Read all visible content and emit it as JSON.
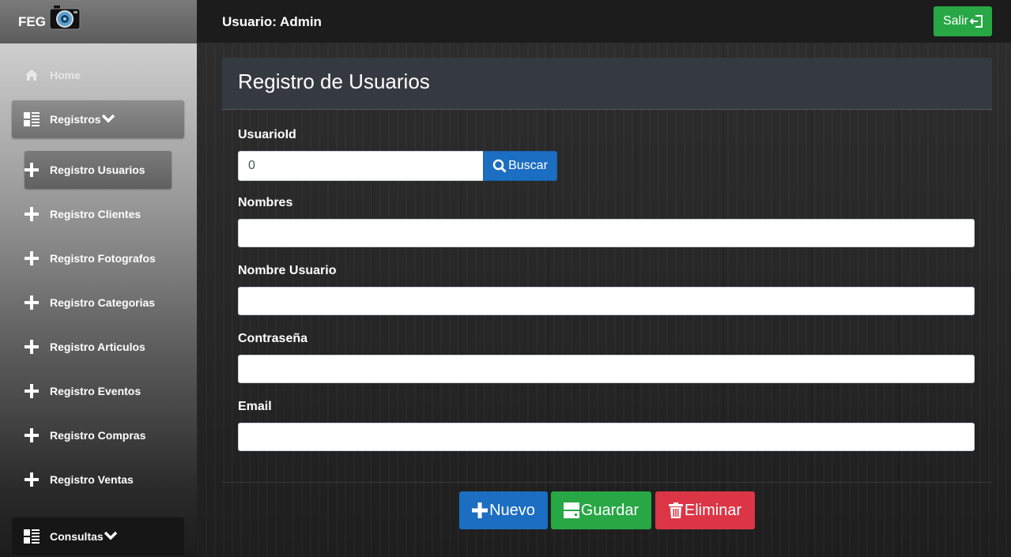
{
  "brand": {
    "text": "FEG"
  },
  "sidebar": {
    "home": {
      "label": "Home",
      "icon": "home-icon"
    },
    "registros": {
      "label": "Registros",
      "icon": "list-icon"
    },
    "sub_items": [
      {
        "label": "Registro Usuarios",
        "active": true
      },
      {
        "label": "Registro Clientes"
      },
      {
        "label": "Registro Fotografos"
      },
      {
        "label": "Registro Categorias"
      },
      {
        "label": "Registro Articulos"
      },
      {
        "label": "Registro Eventos"
      },
      {
        "label": "Registro Compras"
      },
      {
        "label": "Registro Ventas"
      }
    ],
    "consultas": {
      "label": "Consultas",
      "icon": "list-icon"
    }
  },
  "topbar": {
    "user_label": "Usuario: Admin",
    "logout_label": "Salir"
  },
  "form": {
    "title": "Registro de Usuarios",
    "usuarioid": {
      "label": "UsuarioId",
      "value": "0",
      "search_label": "Buscar"
    },
    "nombres": {
      "label": "Nombres",
      "value": ""
    },
    "nombre_usuario": {
      "label": "Nombre Usuario",
      "value": ""
    },
    "contrasena": {
      "label": "Contraseña",
      "value": ""
    },
    "email": {
      "label": "Email",
      "value": ""
    }
  },
  "actions": {
    "nuevo": "Nuevo",
    "guardar": "Guardar",
    "eliminar": "Eliminar"
  },
  "colors": {
    "primary": "#1b6ec2",
    "success": "#28a745",
    "danger": "#dc3545",
    "card_header": "#343a40"
  }
}
